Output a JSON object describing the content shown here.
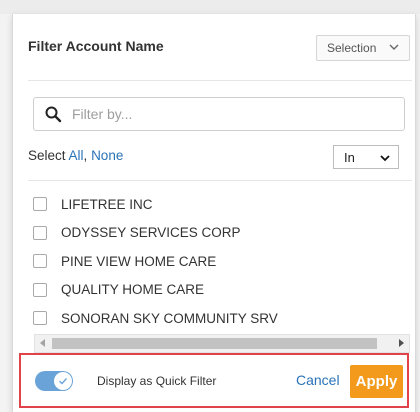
{
  "header": {
    "title": "Filter Account Name",
    "mode_select": "Selection"
  },
  "search": {
    "placeholder": "Filter by..."
  },
  "selection": {
    "prefix": "Select ",
    "all": "All",
    "separator": ", ",
    "none": "None",
    "operator": "In"
  },
  "accounts": [
    "LIFETREE INC",
    "ODYSSEY SERVICES CORP",
    "PINE VIEW HOME CARE",
    "QUALITY HOME CARE",
    "SONORAN SKY COMMUNITY SRV"
  ],
  "footer": {
    "quick_filter_label": "Display as Quick Filter",
    "quick_filter_on": true,
    "cancel_label": "Cancel",
    "apply_label": "Apply"
  },
  "colors": {
    "accent_blue": "#2a73b8",
    "apply_orange": "#f39a1d",
    "toggle_blue": "#6aa3d8",
    "highlight_red": "#e0434a"
  }
}
